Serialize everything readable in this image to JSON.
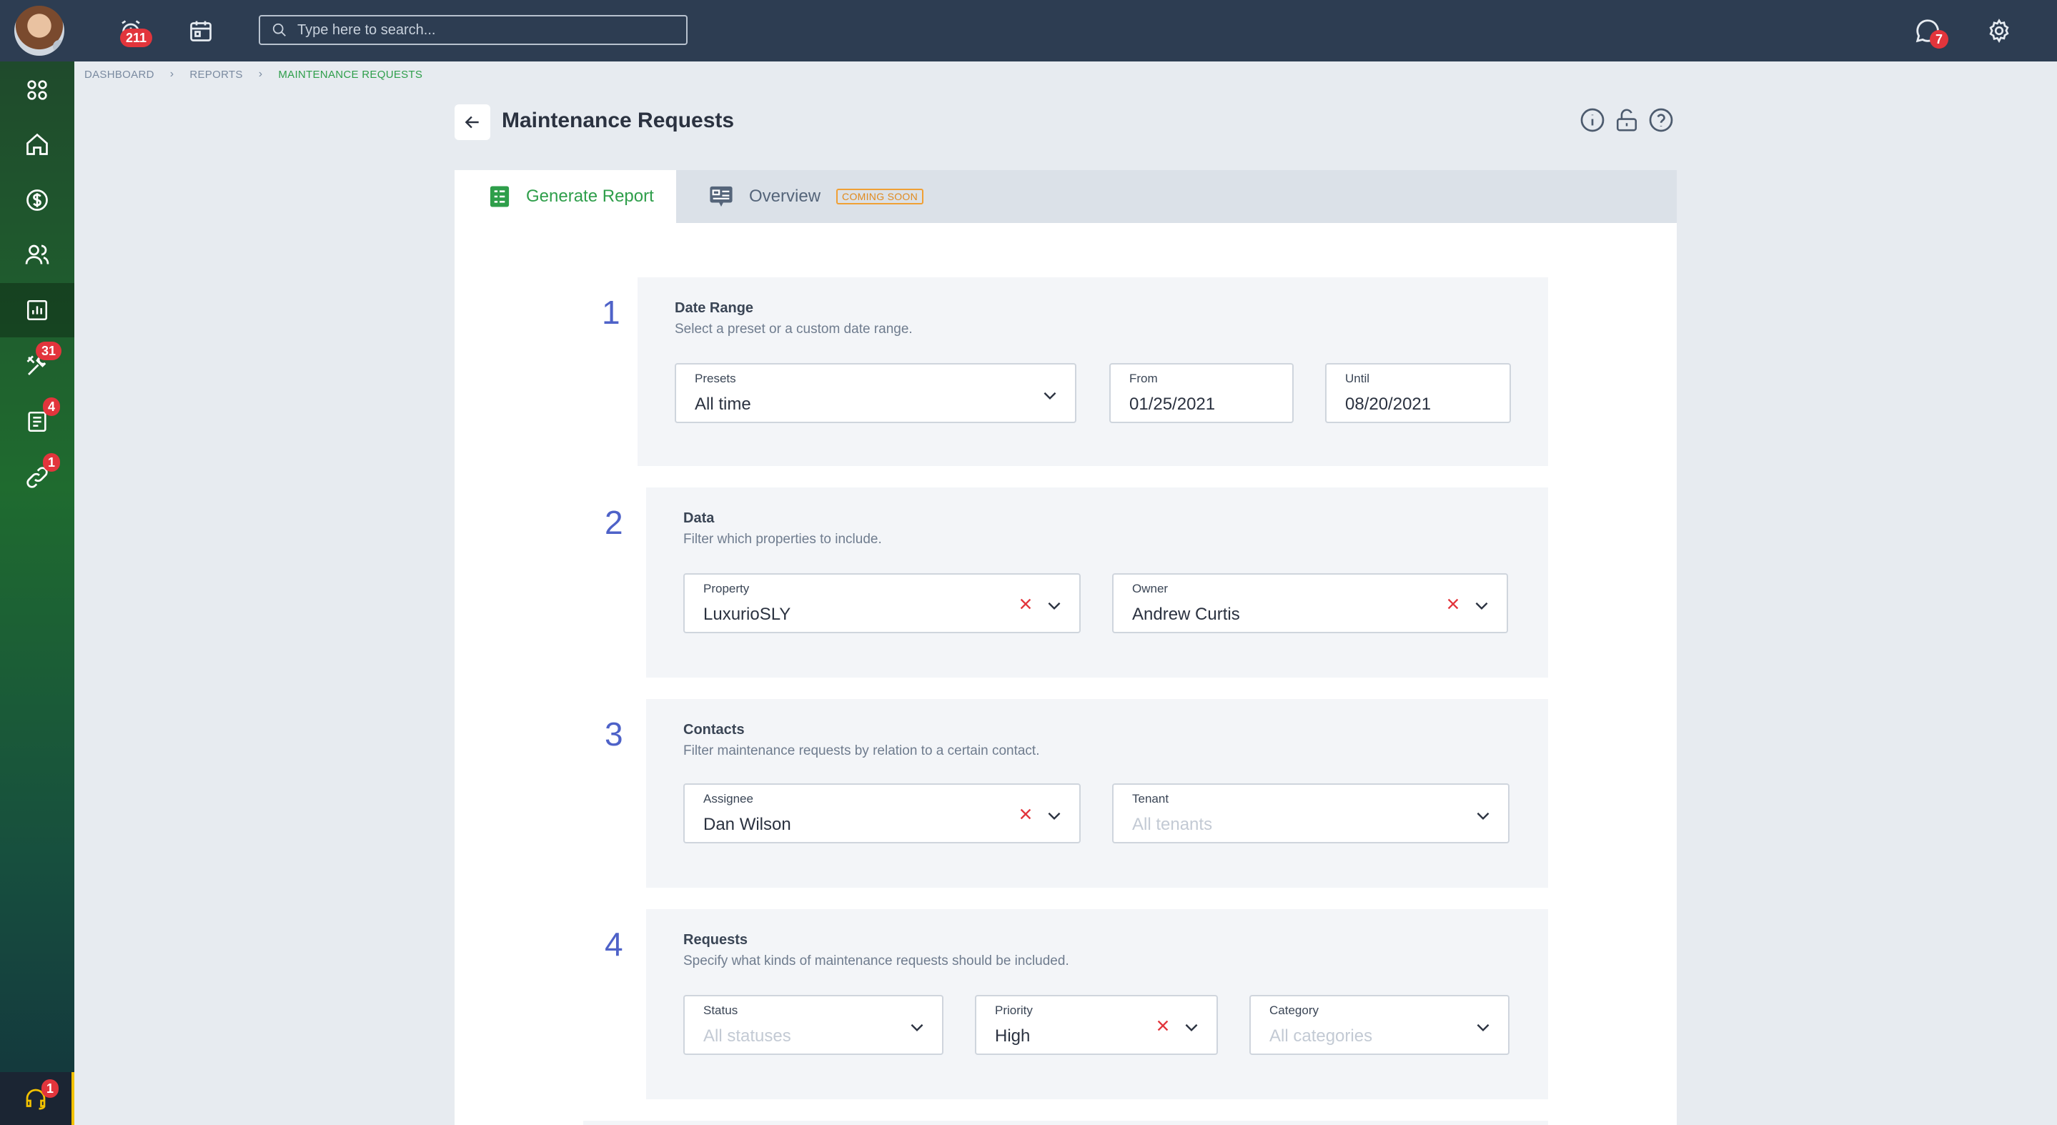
{
  "topbar": {
    "alerts_count": "211",
    "search_placeholder": "Type here to search...",
    "messages_count": "7"
  },
  "sidebar": {
    "badges": {
      "maintenance": "31",
      "documents": "4",
      "links": "1",
      "support": "1"
    }
  },
  "breadcrumb": [
    "DASHBOARD",
    "REPORTS",
    "MAINTENANCE REQUESTS"
  ],
  "page": {
    "title": "Maintenance Requests"
  },
  "tabs": [
    {
      "label": "Generate Report"
    },
    {
      "label": "Overview",
      "badge": "COMING SOON"
    }
  ],
  "sections": [
    {
      "number": "1",
      "title": "Date Range",
      "description": "Select a preset or a custom date range.",
      "fields": {
        "presets": {
          "label": "Presets",
          "value": "All time"
        },
        "from": {
          "label": "From",
          "value": "01/25/2021"
        },
        "until": {
          "label": "Until",
          "value": "08/20/2021"
        }
      }
    },
    {
      "number": "2",
      "title": "Data",
      "description": "Filter which properties to include.",
      "fields": {
        "property": {
          "label": "Property",
          "value": "LuxurioSLY"
        },
        "owner": {
          "label": "Owner",
          "value": "Andrew Curtis"
        }
      }
    },
    {
      "number": "3",
      "title": "Contacts",
      "description": "Filter maintenance requests by relation to a certain contact.",
      "fields": {
        "assignee": {
          "label": "Assignee",
          "value": "Dan Wilson"
        },
        "tenant": {
          "label": "Tenant",
          "placeholder": "All tenants"
        }
      }
    },
    {
      "number": "4",
      "title": "Requests",
      "description": "Specify what kinds of maintenance requests should be included.",
      "fields": {
        "status": {
          "label": "Status",
          "placeholder": "All statuses"
        },
        "priority": {
          "label": "Priority",
          "value": "High"
        },
        "category": {
          "label": "Category",
          "placeholder": "All categories"
        }
      }
    }
  ],
  "colors": {
    "accent_green": "#2e9e4a",
    "number_blue": "#4e62c8",
    "badge_red": "#e2353c",
    "topbar": "#2d3d52",
    "coming_soon": "#f0a035"
  }
}
